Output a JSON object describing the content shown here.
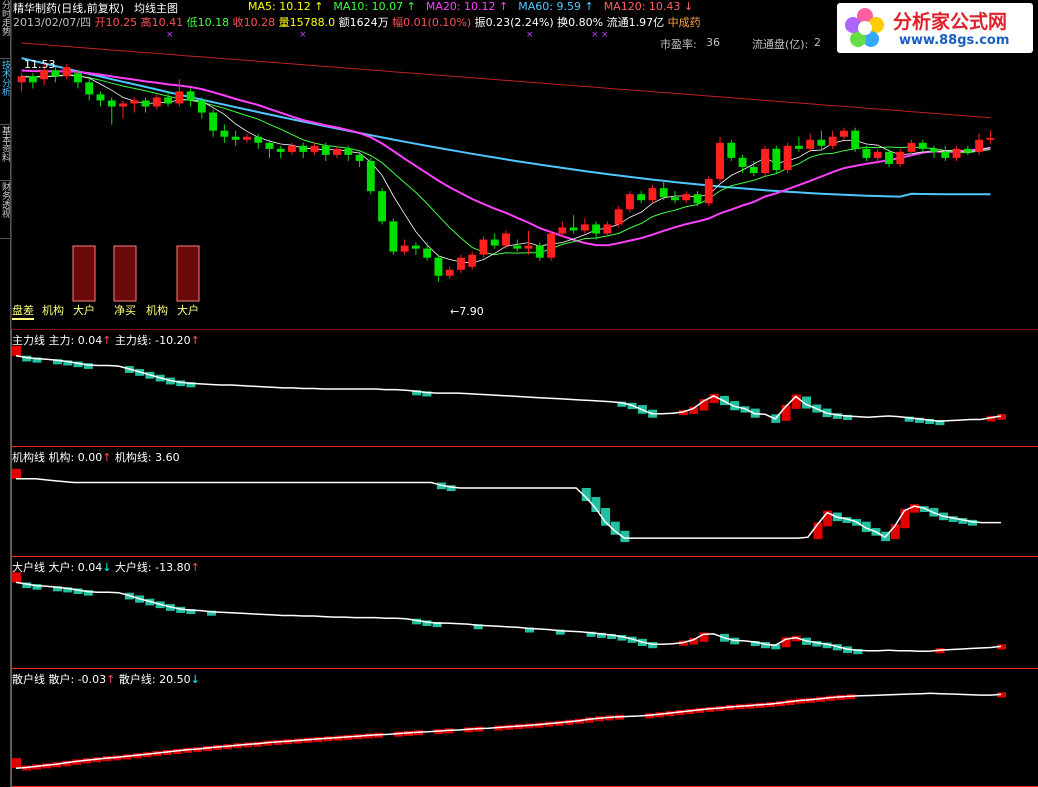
{
  "header": {
    "stock_title": "精华制药(日线,前复权)",
    "template_name": "均线主图",
    "ma": [
      {
        "label": "MA5: 10.12",
        "arrow": "↑",
        "color": "#ffff00"
      },
      {
        "label": "MA10: 10.07",
        "arrow": "↑",
        "color": "#40ff40"
      },
      {
        "label": "MA20: 10.12",
        "arrow": "↑",
        "color": "#ff40ff"
      },
      {
        "label": "MA60: 9.59",
        "arrow": "↑",
        "color": "#4fc8ff"
      },
      {
        "label": "MA120: 10.43",
        "arrow": "↓",
        "color": "#ff6060"
      }
    ],
    "date": "2013/02/07/四",
    "open": "开10.25",
    "high": "高10.41",
    "low": "低10.18",
    "close": "收10.28",
    "volume": "量15788.0",
    "amount": "额1624万",
    "change": "幅0.01(0.10%)",
    "amplitude": "振0.23(2.24%)",
    "turnover": "换0.80%",
    "float": "流通1.97亿",
    "sector": "中成药",
    "pe_label": "市盈率:",
    "pe_value": "36",
    "float_cap_label": "流通盘(亿):",
    "float_cap_value": "2"
  },
  "logo": {
    "text": "分析家公式网",
    "url": "www.88gs.com"
  },
  "sidebar": {
    "tabs": [
      {
        "label": "分时走势",
        "active": false
      },
      {
        "label": "技术分析",
        "active": true
      },
      {
        "label": "基本资料",
        "active": false
      },
      {
        "label": "财务透视",
        "active": false
      }
    ]
  },
  "main_chart": {
    "high_marker": "11.53",
    "low_marker": "←7.90",
    "buttons": [
      "盘差",
      "机构",
      "大户",
      "净买",
      "机构",
      "大户"
    ]
  },
  "panels": [
    {
      "name": "主力线",
      "items": [
        {
          "label": "主力: 0.04",
          "arrow": "↑",
          "arrow_color": "#ff5050"
        },
        {
          "label": "主力线: -10.20",
          "arrow": "↑",
          "arrow_color": "#ff5050"
        }
      ]
    },
    {
      "name": "机构线",
      "items": [
        {
          "label": "机构: 0.00",
          "arrow": "↑",
          "arrow_color": "#ff5050"
        },
        {
          "label": "机构线: 3.60",
          "arrow": "",
          "arrow_color": ""
        }
      ]
    },
    {
      "name": "大户线",
      "items": [
        {
          "label": "大户: 0.04",
          "arrow": "↓",
          "arrow_color": "#00ffff"
        },
        {
          "label": "大户线: -13.80",
          "arrow": "↑",
          "arrow_color": "#ff5050"
        }
      ]
    },
    {
      "name": "散户线",
      "items": [
        {
          "label": "散户: -0.03",
          "arrow": "↑",
          "arrow_color": "#ff5050"
        },
        {
          "label": "散户线: 20.50",
          "arrow": "↓",
          "arrow_color": "#00ffff"
        }
      ]
    }
  ],
  "chart_data": [
    {
      "type": "candlestick",
      "ylim": [
        7.6,
        11.9
      ],
      "annotations": {
        "high": 11.53,
        "low": 7.9
      },
      "candles": [
        [
          11.2,
          11.3,
          11.05,
          11.35
        ],
        [
          11.3,
          11.2,
          11.1,
          11.35
        ],
        [
          11.25,
          11.4,
          11.15,
          11.53
        ],
        [
          11.4,
          11.3,
          11.2,
          11.45
        ],
        [
          11.3,
          11.45,
          11.25,
          11.5
        ],
        [
          11.35,
          11.2,
          11.1,
          11.4
        ],
        [
          11.2,
          11.0,
          10.9,
          11.25
        ],
        [
          11.0,
          10.9,
          10.8,
          11.05
        ],
        [
          10.9,
          10.8,
          10.5,
          10.95
        ],
        [
          10.8,
          10.85,
          10.6,
          10.9
        ],
        [
          10.85,
          10.9,
          10.7,
          10.95
        ],
        [
          10.9,
          10.8,
          10.7,
          10.95
        ],
        [
          10.8,
          10.95,
          10.75,
          11.0
        ],
        [
          10.95,
          10.85,
          10.8,
          11.05
        ],
        [
          10.85,
          11.05,
          10.8,
          11.25
        ],
        [
          11.05,
          10.9,
          10.8,
          11.1
        ],
        [
          10.9,
          10.7,
          10.6,
          10.95
        ],
        [
          10.7,
          10.4,
          10.3,
          10.75
        ],
        [
          10.4,
          10.3,
          10.2,
          10.5
        ],
        [
          10.3,
          10.25,
          10.15,
          10.4
        ],
        [
          10.25,
          10.3,
          10.2,
          10.35
        ],
        [
          10.3,
          10.2,
          10.1,
          10.35
        ],
        [
          10.2,
          10.1,
          9.95,
          10.25
        ],
        [
          10.1,
          10.05,
          9.95,
          10.15
        ],
        [
          10.05,
          10.15,
          10.0,
          10.2
        ],
        [
          10.15,
          10.05,
          9.95,
          10.2
        ],
        [
          10.05,
          10.15,
          10.0,
          10.2
        ],
        [
          10.15,
          10.0,
          9.9,
          10.2
        ],
        [
          10.0,
          10.1,
          9.95,
          10.15
        ],
        [
          10.1,
          10.0,
          9.9,
          10.15
        ],
        [
          10.0,
          9.9,
          9.8,
          10.05
        ],
        [
          9.9,
          9.4,
          9.35,
          9.95
        ],
        [
          9.4,
          8.9,
          8.85,
          9.45
        ],
        [
          8.9,
          8.4,
          8.35,
          8.95
        ],
        [
          8.4,
          8.5,
          8.35,
          8.6
        ],
        [
          8.5,
          8.45,
          8.35,
          8.55
        ],
        [
          8.45,
          8.3,
          8.25,
          8.55
        ],
        [
          8.3,
          8.0,
          7.9,
          8.35
        ],
        [
          8.0,
          8.1,
          7.95,
          8.15
        ],
        [
          8.1,
          8.3,
          8.05,
          8.35
        ],
        [
          8.15,
          8.35,
          8.1,
          8.4
        ],
        [
          8.35,
          8.6,
          8.3,
          8.65
        ],
        [
          8.6,
          8.5,
          8.45,
          8.7
        ],
        [
          8.5,
          8.7,
          8.45,
          8.75
        ],
        [
          8.5,
          8.45,
          8.4,
          8.6
        ],
        [
          8.45,
          8.5,
          8.35,
          8.75
        ],
        [
          8.5,
          8.3,
          8.25,
          8.55
        ],
        [
          8.3,
          8.7,
          8.25,
          8.75
        ],
        [
          8.7,
          8.8,
          8.65,
          8.9
        ],
        [
          8.8,
          8.75,
          8.7,
          9.0
        ],
        [
          8.75,
          8.85,
          8.7,
          8.95
        ],
        [
          8.85,
          8.7,
          8.6,
          8.9
        ],
        [
          8.7,
          8.85,
          8.65,
          8.9
        ],
        [
          8.85,
          9.1,
          8.8,
          9.15
        ],
        [
          9.1,
          9.35,
          9.05,
          9.4
        ],
        [
          9.35,
          9.25,
          9.2,
          9.4
        ],
        [
          9.25,
          9.45,
          9.2,
          9.5
        ],
        [
          9.45,
          9.3,
          9.25,
          9.55
        ],
        [
          9.3,
          9.25,
          9.2,
          9.4
        ],
        [
          9.25,
          9.35,
          9.2,
          9.4
        ],
        [
          9.35,
          9.2,
          9.15,
          9.4
        ],
        [
          9.2,
          9.6,
          9.15,
          9.65
        ],
        [
          9.6,
          10.2,
          9.55,
          10.3
        ],
        [
          10.2,
          9.95,
          9.9,
          10.25
        ],
        [
          9.95,
          9.8,
          9.7,
          10.0
        ],
        [
          9.8,
          9.7,
          9.65,
          9.9
        ],
        [
          9.7,
          10.1,
          9.65,
          10.15
        ],
        [
          10.1,
          9.75,
          9.7,
          10.15
        ],
        [
          9.75,
          10.15,
          9.7,
          10.2
        ],
        [
          10.15,
          10.1,
          10.05,
          10.3
        ],
        [
          10.1,
          10.25,
          10.05,
          10.35
        ],
        [
          10.25,
          10.15,
          10.1,
          10.4
        ],
        [
          10.15,
          10.3,
          10.1,
          10.4
        ],
        [
          10.3,
          10.4,
          10.25,
          10.45
        ],
        [
          10.4,
          10.1,
          10.05,
          10.45
        ],
        [
          10.1,
          9.95,
          9.9,
          10.15
        ],
        [
          9.95,
          10.05,
          9.85,
          10.1
        ],
        [
          10.05,
          9.85,
          9.8,
          10.1
        ],
        [
          9.85,
          10.05,
          9.8,
          10.1
        ],
        [
          10.05,
          10.2,
          10.0,
          10.25
        ],
        [
          10.2,
          10.1,
          10.05,
          10.25
        ],
        [
          10.1,
          10.05,
          9.95,
          10.15
        ],
        [
          10.05,
          9.95,
          9.9,
          10.15
        ],
        [
          9.95,
          10.1,
          9.9,
          10.15
        ],
        [
          10.1,
          10.05,
          10.0,
          10.15
        ],
        [
          10.05,
          10.25,
          10.0,
          10.35
        ],
        [
          10.25,
          10.28,
          10.18,
          10.41
        ]
      ]
    },
    {
      "type": "line",
      "name": "主力线",
      "ylim": [
        -14.5,
        1.0
      ],
      "values": [
        0.0,
        -0.3,
        -0.5,
        -0.6,
        -0.8,
        -1.0,
        -1.3,
        -1.6,
        -1.7,
        -1.7,
        -1.8,
        -2.3,
        -2.8,
        -3.3,
        -3.8,
        -4.3,
        -4.6,
        -4.8,
        -4.9,
        -5.0,
        -5.1,
        -5.1,
        -5.2,
        -5.3,
        -5.4,
        -5.5,
        -5.6,
        -5.6,
        -5.7,
        -5.7,
        -5.8,
        -5.8,
        -5.8,
        -5.8,
        -5.8,
        -5.8,
        -5.9,
        -5.9,
        -6.0,
        -6.2,
        -6.4,
        -6.5,
        -6.5,
        -6.5,
        -6.6,
        -6.7,
        -6.8,
        -6.9,
        -7.0,
        -7.1,
        -7.2,
        -7.3,
        -7.4,
        -7.5,
        -7.6,
        -7.7,
        -7.8,
        -7.9,
        -8.0,
        -8.2,
        -8.6,
        -9.4,
        -10.1,
        -10.1,
        -10.0,
        -9.8,
        -9.2,
        -7.9,
        -7.0,
        -7.9,
        -8.8,
        -9.2,
        -10.1,
        -10.2,
        -11.0,
        -8.9,
        -7.1,
        -8.5,
        -9.2,
        -10.0,
        -10.3,
        -10.5,
        -10.6,
        -10.7,
        -10.6,
        -10.5,
        -10.6,
        -10.8,
        -11.0,
        -11.2,
        -11.4,
        -11.3,
        -11.2,
        -11.1,
        -11.1,
        -10.8,
        -10.5
      ]
    },
    {
      "type": "line",
      "name": "机构线",
      "ylim": [
        -6.5,
        2.5
      ],
      "values": [
        1.2,
        1.2,
        1.2,
        1.1,
        1.0,
        0.9,
        0.8,
        0.8,
        0.8,
        0.8,
        0.8,
        0.8,
        0.8,
        0.8,
        0.8,
        0.8,
        0.8,
        0.8,
        0.8,
        0.8,
        0.8,
        0.8,
        0.8,
        0.8,
        0.8,
        0.8,
        0.8,
        0.8,
        0.8,
        0.8,
        0.8,
        0.8,
        0.8,
        0.8,
        0.8,
        0.8,
        0.8,
        0.8,
        0.8,
        0.8,
        0.8,
        0.8,
        0.8,
        0.8,
        0.5,
        0.3,
        0.2,
        0.2,
        0.2,
        0.2,
        0.2,
        0.2,
        0.2,
        0.2,
        0.2,
        0.2,
        0.2,
        0.2,
        0.2,
        -0.8,
        -2.0,
        -3.5,
        -4.5,
        -5.3,
        -5.3,
        -5.3,
        -5.3,
        -5.3,
        -5.3,
        -5.3,
        -5.3,
        -5.3,
        -5.3,
        -5.3,
        -5.3,
        -5.3,
        -5.3,
        -5.3,
        -5.3,
        -5.3,
        -5.3,
        -5.3,
        -5.2,
        -3.8,
        -2.5,
        -3.0,
        -3.2,
        -3.5,
        -4.2,
        -4.6,
        -5.2,
        -4.0,
        -2.3,
        -1.8,
        -2.0,
        -2.5,
        -2.9,
        -3.1,
        -3.3,
        -3.5,
        -3.6,
        -3.6,
        -3.6
      ]
    },
    {
      "type": "line",
      "name": "大户线",
      "ylim": [
        -14.5,
        1.0
      ],
      "values": [
        0.0,
        -0.3,
        -0.6,
        -0.7,
        -0.9,
        -1.1,
        -1.4,
        -1.7,
        -1.8,
        -1.8,
        -1.9,
        -2.4,
        -3.0,
        -3.5,
        -4.0,
        -4.5,
        -4.9,
        -5.1,
        -5.2,
        -5.4,
        -5.5,
        -5.6,
        -5.7,
        -5.8,
        -5.9,
        -6.0,
        -6.1,
        -6.1,
        -6.2,
        -6.2,
        -6.3,
        -6.4,
        -6.4,
        -6.5,
        -6.5,
        -6.5,
        -6.6,
        -6.6,
        -6.7,
        -7.0,
        -7.3,
        -7.5,
        -7.5,
        -7.6,
        -7.7,
        -7.9,
        -8.0,
        -8.1,
        -8.2,
        -8.3,
        -8.5,
        -8.6,
        -8.7,
        -8.9,
        -9.0,
        -9.1,
        -9.3,
        -9.5,
        -9.7,
        -10.0,
        -10.4,
        -11.0,
        -11.4,
        -11.4,
        -11.3,
        -11.1,
        -10.6,
        -9.6,
        -9.5,
        -10.2,
        -10.7,
        -10.8,
        -11.0,
        -11.4,
        -11.6,
        -10.5,
        -10.2,
        -10.8,
        -11.1,
        -11.4,
        -11.8,
        -12.3,
        -12.5,
        -12.6,
        -12.6,
        -12.5,
        -12.6,
        -12.6,
        -12.7,
        -12.7,
        -12.5,
        -12.4,
        -12.3,
        -12.2,
        -12.1,
        -12.0,
        -11.8
      ]
    },
    {
      "type": "line",
      "name": "散户线",
      "ylim": [
        -3.0,
        22.0
      ],
      "values": [
        0.0,
        0.2,
        0.5,
        0.8,
        1.1,
        1.5,
        1.9,
        2.2,
        2.5,
        2.8,
        3.0,
        3.3,
        3.6,
        3.9,
        4.2,
        4.5,
        4.8,
        5.1,
        5.3,
        5.6,
        5.9,
        6.1,
        6.4,
        6.6,
        6.8,
        7.1,
        7.3,
        7.5,
        7.7,
        7.9,
        8.1,
        8.3,
        8.5,
        8.7,
        8.9,
        9.1,
        9.3,
        9.4,
        9.6,
        9.8,
        10.0,
        10.1,
        10.3,
        10.5,
        10.6,
        10.8,
        11.0,
        11.1,
        11.3,
        11.5,
        11.7,
        11.9,
        12.1,
        12.4,
        12.6,
        12.9,
        13.2,
        13.6,
        13.9,
        14.1,
        14.3,
        14.4,
        14.5,
        14.7,
        15.0,
        15.3,
        15.6,
        15.9,
        16.2,
        16.5,
        16.7,
        17.0,
        17.2,
        17.4,
        17.6,
        17.8,
        18.1,
        18.5,
        18.8,
        19.0,
        19.3,
        19.6,
        19.8,
        20.0,
        20.1,
        20.2,
        20.3,
        20.4,
        20.5,
        20.6,
        20.7,
        20.8,
        20.7,
        20.6,
        20.5,
        20.4,
        20.3,
        20.3,
        20.5
      ]
    }
  ]
}
